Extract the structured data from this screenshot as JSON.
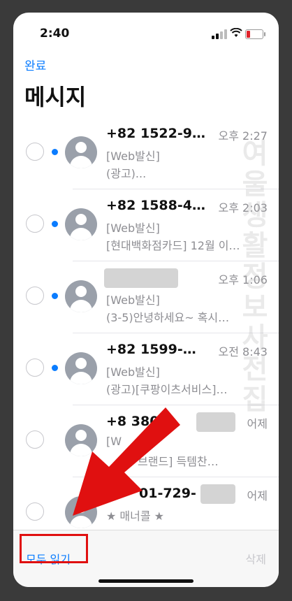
{
  "status_bar": {
    "time": "2:40"
  },
  "header": {
    "done_label": "완료",
    "title": "메시지"
  },
  "messages": [
    {
      "sender": "+82 1522-9…",
      "time": "오후 2:27",
      "line1": "[Web발신]",
      "line2": "(광고)...",
      "unread": true
    },
    {
      "sender": "+82 1588-4…",
      "time": "오후 2:03",
      "line1": "[Web발신]",
      "line2": "[현대백화점카드] 12월 이…",
      "unread": true
    },
    {
      "sender": "",
      "time": "오후 1:06",
      "line1": "[Web발신]",
      "line2": "(3-5)안녕하세요~ 혹시…",
      "unread": true
    },
    {
      "sender": "+82 1599-…",
      "time": "오전 8:43",
      "line1": "[Web발신]",
      "line2": "(광고)[쿠팡이츠서비스]…",
      "unread": true
    },
    {
      "sender": "+8 380-",
      "time": "어제",
      "line1": "[W",
      "line2": "브랜드] 득템찬…",
      "unread": false
    },
    {
      "sender": "01-729-",
      "time": "어제",
      "line1": "★ 매너콜 ★",
      "line2": "",
      "unread": false
    }
  ],
  "watermark": "여울생활정보사전집",
  "bottom_bar": {
    "read_all_label": "모두 읽기",
    "delete_label": "삭제"
  },
  "colors": {
    "accent": "#0a7cff",
    "annotation": "#e01010"
  }
}
